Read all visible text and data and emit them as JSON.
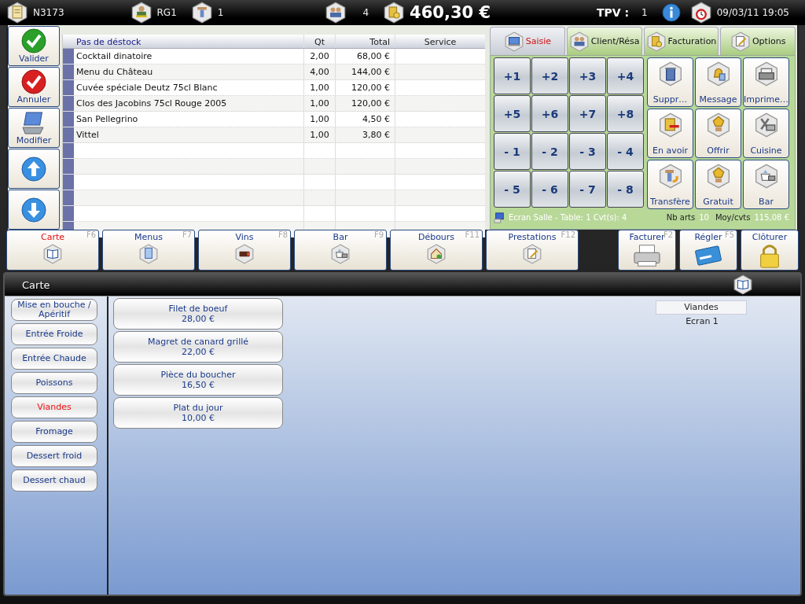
{
  "top_bar": {
    "ticket": "N3173",
    "waiter": "RG1",
    "table": "1",
    "covers": "4",
    "total": "460,30 €",
    "tpv_label": "TPV :",
    "tpv": "1",
    "datetime": "09/03/11 19:05"
  },
  "actions": [
    {
      "kind": "confirm",
      "label": "Valider"
    },
    {
      "kind": "cancel",
      "label": "Annuler"
    },
    {
      "kind": "edit",
      "label": "Modifier"
    },
    {
      "kind": "scroll_up"
    },
    {
      "kind": "scroll_down"
    }
  ],
  "order": {
    "columns": [
      "Pas de déstock",
      "Qt",
      "Total",
      "Service"
    ],
    "rows": [
      {
        "item": "Cocktail dinatoire",
        "qty": "2,00",
        "total": "68,00 €"
      },
      {
        "item": "Menu du Château",
        "qty": "4,00",
        "total": "144,00 €"
      },
      {
        "item": "Cuvée spéciale Deutz 75cl Blanc",
        "qty": "1,00",
        "total": "120,00 €"
      },
      {
        "item": "Clos des Jacobins 75cl Rouge 2005",
        "qty": "1,00",
        "total": "120,00 €"
      },
      {
        "item": "San Pellegrino",
        "qty": "1,00",
        "total": "4,50 €"
      },
      {
        "item": "Vittel",
        "qty": "1,00",
        "total": "3,80 €"
      }
    ]
  },
  "tabs": [
    {
      "label": "Saisie",
      "selected": true
    },
    {
      "label": "Client/Résa",
      "selected": false
    },
    {
      "label": "Facturation",
      "selected": false
    },
    {
      "label": "Options",
      "selected": false
    }
  ],
  "keypad": [
    "+1",
    "+2",
    "+3",
    "+4",
    "+5",
    "+6",
    "+7",
    "+8",
    "- 1",
    "- 2",
    "- 3",
    "- 4",
    "- 5",
    "- 6",
    "- 7",
    "- 8"
  ],
  "tools": [
    {
      "kind": "delete",
      "label": "Suppr…"
    },
    {
      "kind": "message",
      "label": "Message"
    },
    {
      "kind": "print",
      "label": "Imprime…"
    },
    {
      "kind": "credit",
      "label": "En avoir"
    },
    {
      "kind": "offer",
      "label": "Offrir"
    },
    {
      "kind": "kitchen",
      "label": "Cuisine"
    },
    {
      "kind": "transfer",
      "label": "Transfère"
    },
    {
      "kind": "free",
      "label": "Gratuit"
    },
    {
      "kind": "bar",
      "label": "Bar"
    }
  ],
  "status": {
    "screen": "Ecran Salle - Table: 1 Cvt(s): 4",
    "nb_arts_label": "Nb arts",
    "nb_arts": "10",
    "avg_label": "Moy/cvts",
    "avg": "115,08 €"
  },
  "function_keys": [
    {
      "kind": "carte",
      "label": "Carte",
      "key": "F6",
      "selected": true
    },
    {
      "kind": "menus",
      "label": "Menus",
      "key": "F7",
      "selected": false
    },
    {
      "kind": "wines",
      "label": "Vins",
      "key": "F8",
      "selected": false
    },
    {
      "kind": "bar",
      "label": "Bar",
      "key": "F9",
      "selected": false
    },
    {
      "kind": "debours",
      "label": "Débours",
      "key": "F11",
      "selected": false
    },
    {
      "kind": "services",
      "label": "Prestations",
      "key": "F12",
      "selected": false
    },
    {
      "kind": "invoice",
      "label": "Facturer",
      "key": "F2",
      "selected": false
    },
    {
      "kind": "pay",
      "label": "Régler",
      "key": "F5",
      "selected": false
    },
    {
      "kind": "close",
      "label": "Clôturer",
      "selected": false
    }
  ],
  "carte": {
    "title": "Carte",
    "categories": [
      {
        "label": "Mise en bouche / Apéritif",
        "selected": false
      },
      {
        "label": "Entrée Froide",
        "selected": false
      },
      {
        "label": "Entrée Chaude",
        "selected": false
      },
      {
        "label": "Poissons",
        "selected": false
      },
      {
        "label": "Viandes",
        "selected": true
      },
      {
        "label": "Fromage",
        "selected": false
      },
      {
        "label": "Dessert froid",
        "selected": false
      },
      {
        "label": "Dessert chaud",
        "selected": false
      }
    ],
    "products": [
      {
        "name": "Filet de boeuf",
        "price": "28,00 €"
      },
      {
        "name": "Magret de canard grillé",
        "price": "22,00 €"
      },
      {
        "name": "Pièce du boucher",
        "price": "16,50 €"
      },
      {
        "name": "Plat du jour",
        "price": "10,00 €"
      }
    ],
    "breadcrumb": "Viandes",
    "screen": "Ecran 1"
  }
}
